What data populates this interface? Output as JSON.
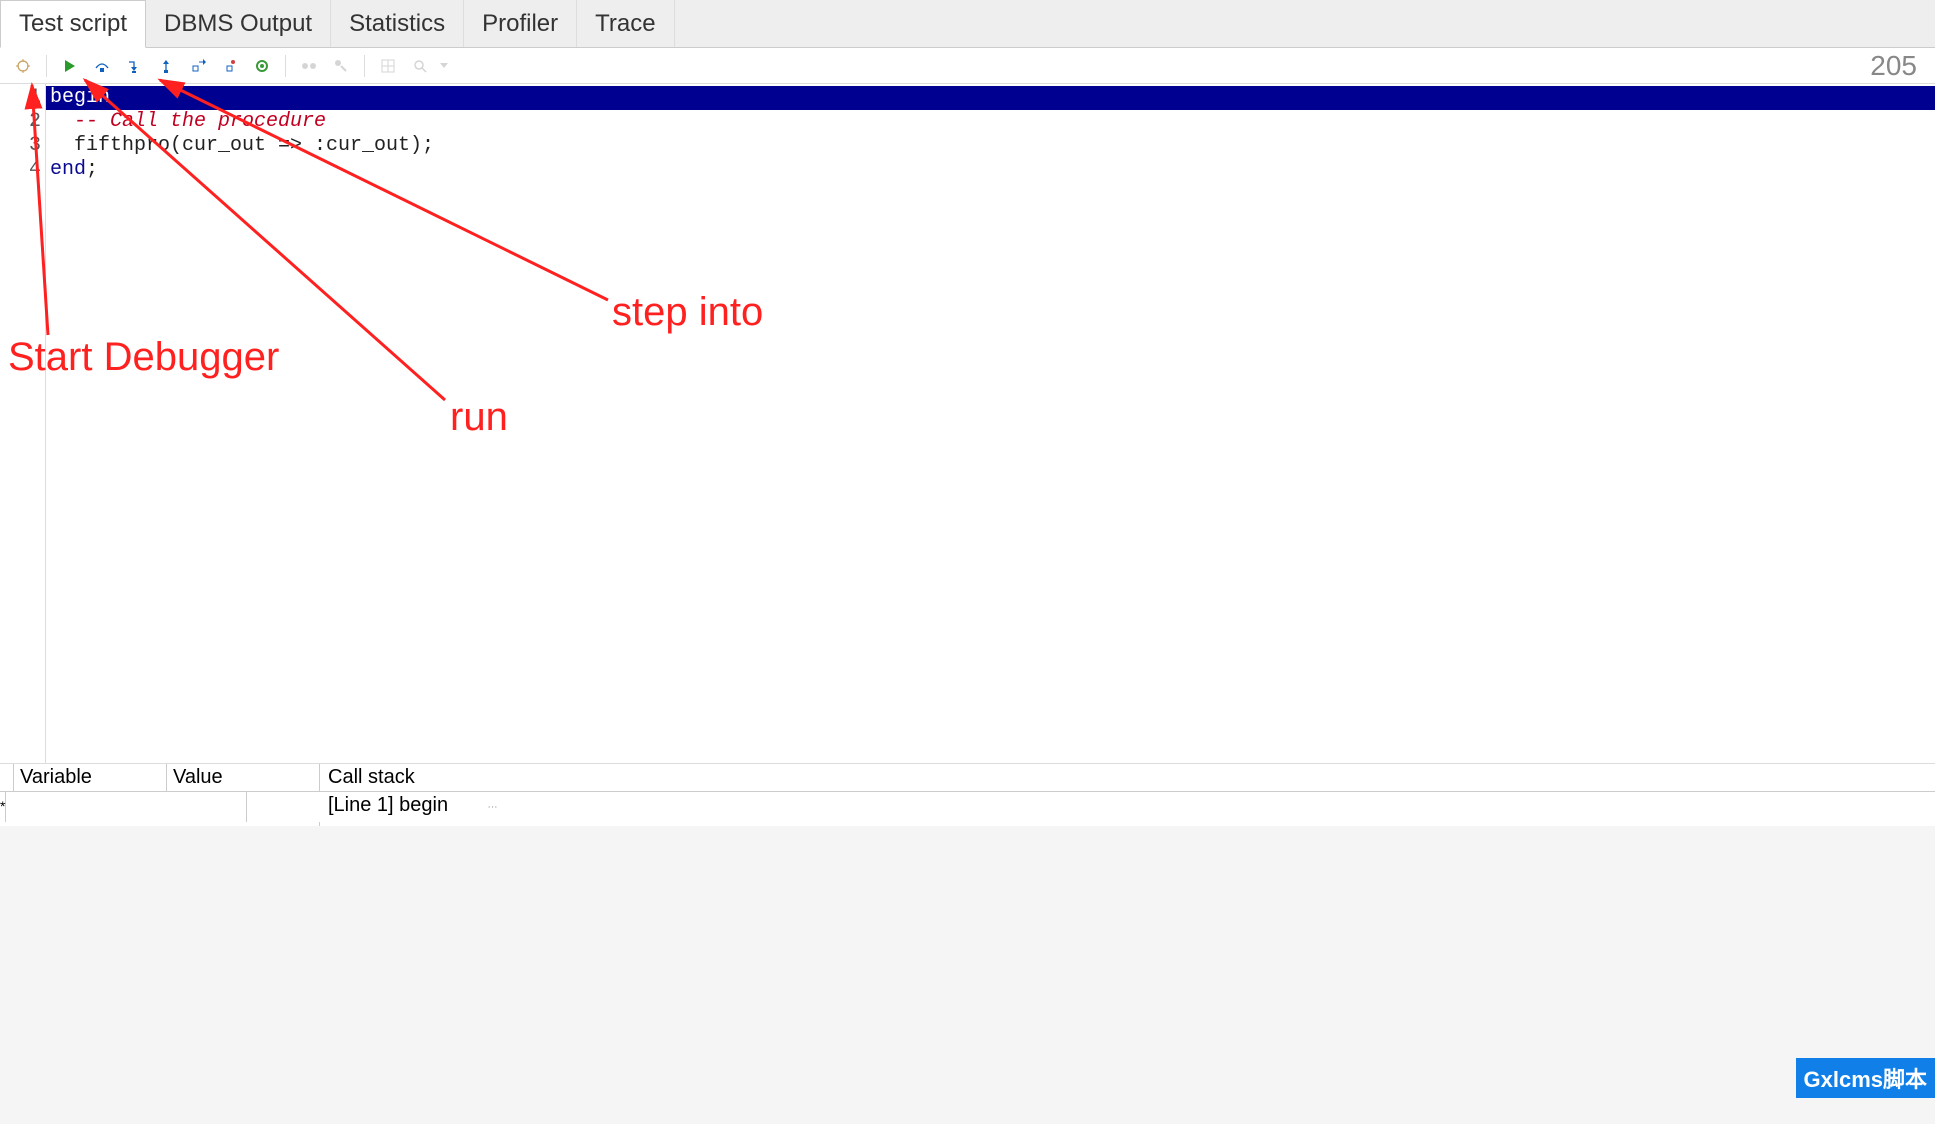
{
  "tabs": [
    {
      "label": "Test script",
      "active": true
    },
    {
      "label": "DBMS Output",
      "active": false
    },
    {
      "label": "Statistics",
      "active": false
    },
    {
      "label": "Profiler",
      "active": false
    },
    {
      "label": "Trace",
      "active": false
    }
  ],
  "toolbar": {
    "counter": "205"
  },
  "code": {
    "lines": [
      {
        "n": "1",
        "parts": [
          {
            "cls": "hl",
            "t": "begin"
          }
        ]
      },
      {
        "n": "2",
        "parts": [
          {
            "cls": "txt",
            "t": "  "
          },
          {
            "cls": "cm",
            "t": "-- Call the procedure"
          }
        ]
      },
      {
        "n": "3",
        "parts": [
          {
            "cls": "txt",
            "t": "  fifthpro(cur_out => :cur_out);"
          }
        ]
      },
      {
        "n": "4",
        "parts": [
          {
            "cls": "kw",
            "t": "end"
          },
          {
            "cls": "txt",
            "t": ";"
          }
        ]
      }
    ]
  },
  "vars_panel": {
    "col1": "Variable",
    "col2": "Value",
    "star": "*"
  },
  "stack_panel": {
    "header": "Call stack",
    "item": "[Line 1] begin"
  },
  "annotations": {
    "a1": "Start Debugger",
    "a2": "run",
    "a3": "step into"
  },
  "watermark": "Gxlcms脚本"
}
